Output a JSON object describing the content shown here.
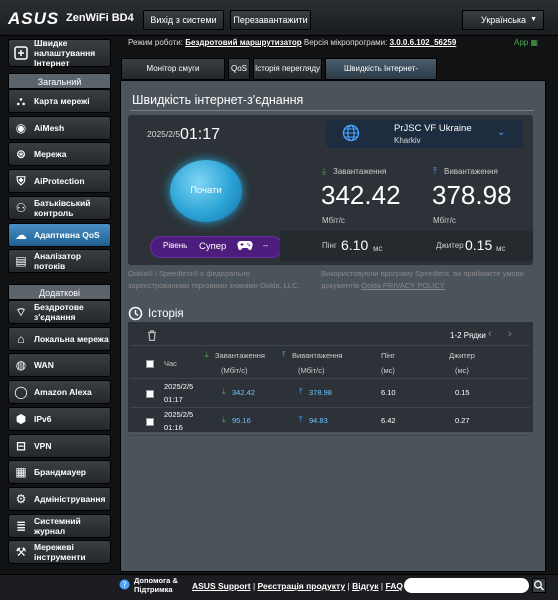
{
  "header": {
    "brand": "ASUS",
    "model": "ZenWiFi BD4",
    "logout": "Вихід з системи",
    "reboot": "Перезавантажити",
    "language": "Українська"
  },
  "sidebar": {
    "quick": "Швидке налаштування Інтернет",
    "general_head": "Загальний",
    "general": [
      {
        "label": "Карта мережі",
        "icon": "network-map-icon"
      },
      {
        "label": "AiMesh",
        "icon": "aimesh-icon"
      },
      {
        "label": "Мережа",
        "icon": "network-icon"
      },
      {
        "label": "AiProtection",
        "icon": "shield-icon"
      },
      {
        "label": "Батьківський контроль",
        "icon": "parental-control-icon"
      },
      {
        "label": "Адаптивна QoS",
        "icon": "qos-icon"
      },
      {
        "label": "Аналізатор потоків",
        "icon": "traffic-analyzer-icon"
      }
    ],
    "advanced_head": "Додаткові налаштування",
    "advanced": [
      {
        "label": "Бездротове з'єднання",
        "icon": "wireless-icon"
      },
      {
        "label": "Локальна мережа",
        "icon": "lan-icon"
      },
      {
        "label": "WAN",
        "icon": "wan-icon"
      },
      {
        "label": "Amazon Alexa",
        "icon": "alexa-icon"
      },
      {
        "label": "IPv6",
        "icon": "ipv6-icon"
      },
      {
        "label": "VPN",
        "icon": "vpn-icon"
      },
      {
        "label": "Брандмауер",
        "icon": "firewall-icon"
      },
      {
        "label": "Адміністрування",
        "icon": "administration-icon"
      },
      {
        "label": "Системний журнал",
        "icon": "system-log-icon"
      },
      {
        "label": "Мережеві інструменти",
        "icon": "network-tools-icon"
      }
    ]
  },
  "status": {
    "mode_label": "Режим роботи:",
    "mode_value": "Бездротовий маршрутизатор",
    "fw_label": "Версія мікропрограми:",
    "fw_value": "3.0.0.6.102_56259",
    "app": "App"
  },
  "tabs": [
    "Монітор смуги пропускання",
    "QoS",
    "Історія перегляду",
    "Швидкість Інтернет-з'єднання"
  ],
  "speedtest": {
    "title": "Швидкість інтернет-з'єднання",
    "date": "2025/2/5",
    "time": "01:17",
    "isp_name": "PrJSC VF Ukraine",
    "isp_city": "Kharkiv",
    "start": "Почати",
    "download_label": "Завантаження",
    "download_value": "342.42",
    "download_unit": "Мбіт/с",
    "upload_label": "Вивантаження",
    "upload_value": "378.98",
    "upload_unit": "Мбіт/с",
    "level_label": "Рівень",
    "level_value": "Супер",
    "game_dashes": "--",
    "ping_label": "Пінг",
    "ping_value": "6.10",
    "ping_unit": "мс",
    "jitter_label": "Джитер",
    "jitter_value": "0.15",
    "jitter_unit": "мс",
    "disclaimer_left": "Ookla® і Speedtest® є федерально зареєстрованими торговими знаками Ookla, LLC.",
    "disclaimer_right_1": "Використовуючи програму Speedtest, ви приймаєте умови",
    "disclaimer_right_2": "документів",
    "privacy_link": "Ookla PRIVACY POLICY"
  },
  "history": {
    "title": "Історія",
    "pager": "1-2 Рядки",
    "columns": {
      "time": "Час",
      "download": "Завантаження",
      "download_unit": "(Мбіт/с)",
      "upload": "Вивантаження",
      "upload_unit": "(Мбіт/с)",
      "ping": "Пінг",
      "ping_unit": "(мс)",
      "jitter": "Джитер",
      "jitter_unit": "(мс)"
    },
    "rows": [
      {
        "date": "2025/2/5",
        "time": "01:17",
        "download": "342.42",
        "upload": "378.98",
        "ping": "6.10",
        "jitter": "0.15"
      },
      {
        "date": "2025/2/5",
        "time": "01:16",
        "download": "95.16",
        "upload": "94.83",
        "ping": "6.42",
        "jitter": "0.27"
      }
    ]
  },
  "footer": {
    "help_1": "Допомога &",
    "help_2": "Підтримка",
    "support": "ASUS Support",
    "sep": "|",
    "registration": "Реєстрація продукту",
    "feedback": "Відгук",
    "faq": "FAQ"
  },
  "colors": {
    "accent": "#2aa3d6",
    "level_pill": "#4d1d7d",
    "up_arrow": "#4aa3ff",
    "down_arrow": "#4caf50"
  }
}
